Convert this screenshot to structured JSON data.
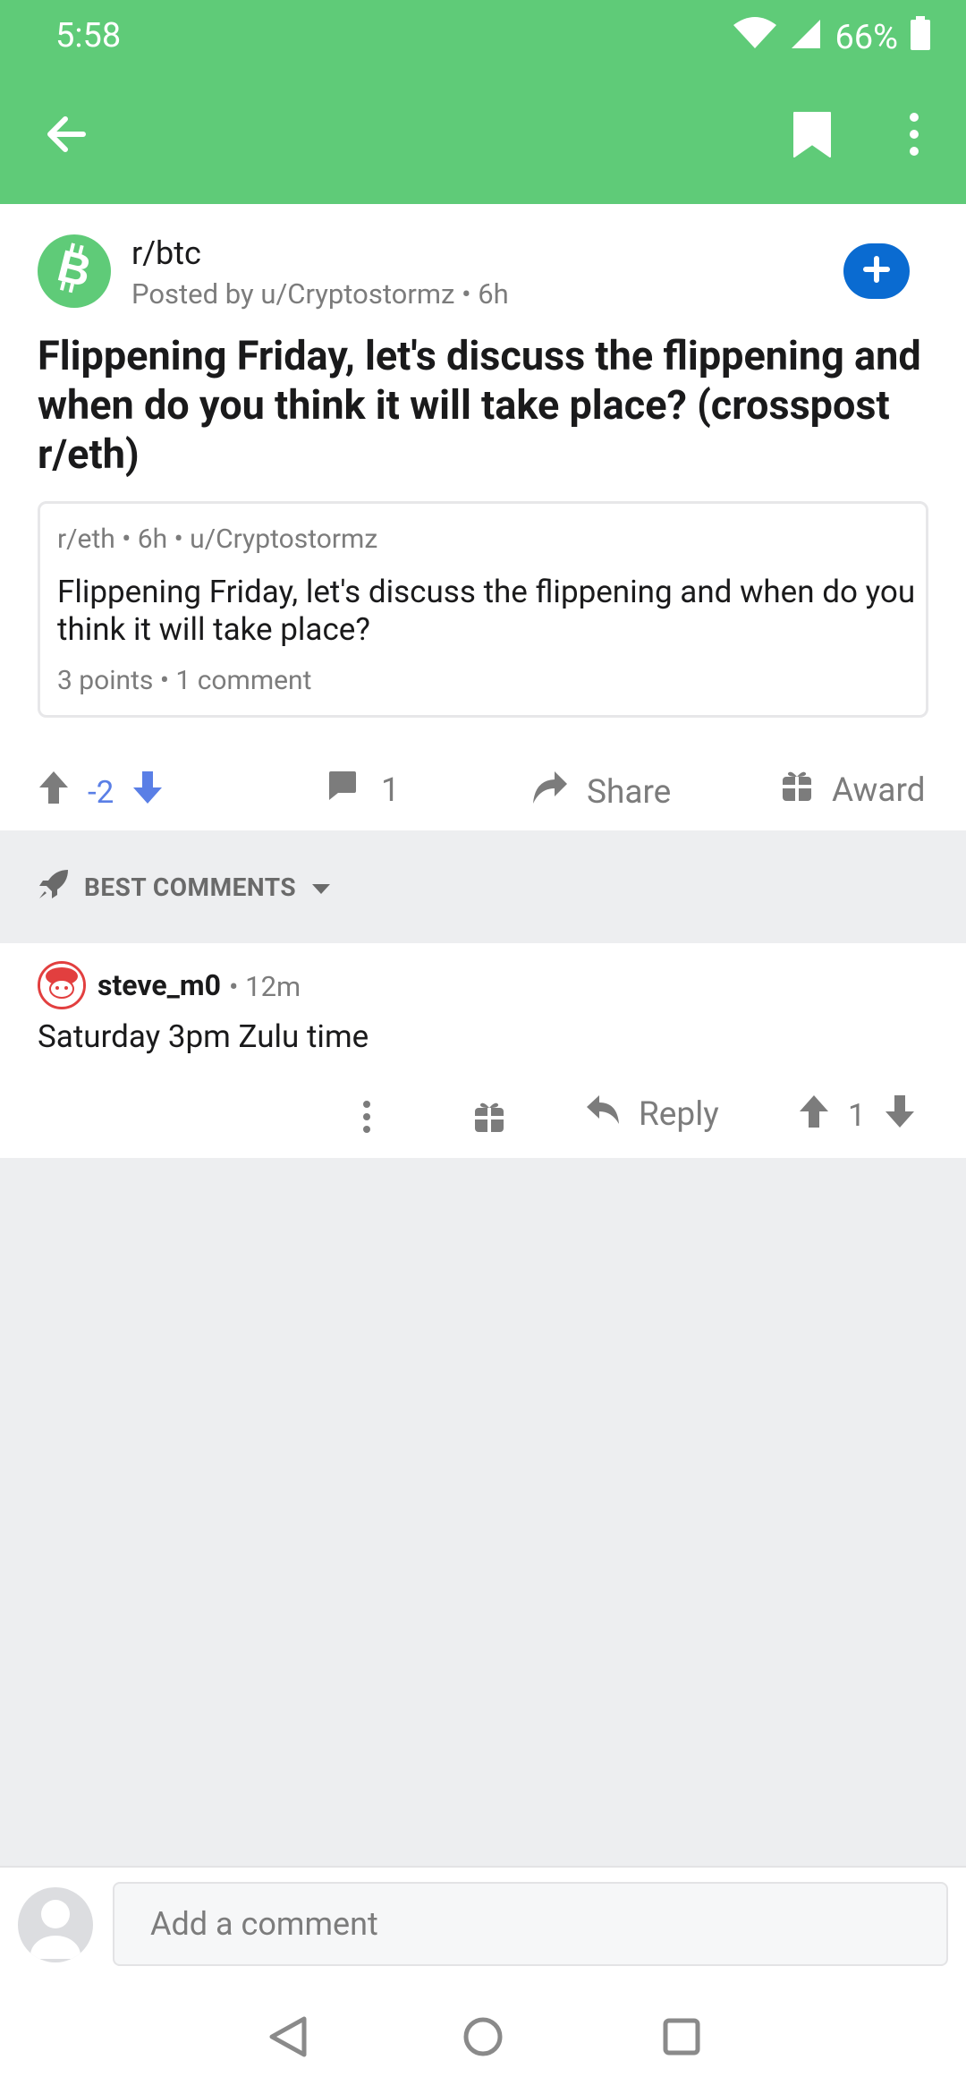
{
  "status_bar": {
    "time": "5:58",
    "battery": "66%"
  },
  "toolbar": {
    "back": "arrow-back-icon",
    "bookmark": "bookmark-icon",
    "more": "more-vertical-icon",
    "color": "#5FCB78"
  },
  "post": {
    "subreddit": "r/btc",
    "posted_by": "Posted by u/Cryptostormz • 6h",
    "title": "Flippening Friday, let's discuss the flippening and when do you think it will take place? (crosspost r/eth)",
    "crosspost": {
      "meta": "r/eth • 6h • u/Cryptostormz",
      "title": "Flippening Friday, let's discuss the flippening and when do you think it will take place?",
      "stats": "3 points • 1 comment"
    },
    "score": "-2",
    "comment_count": "1",
    "share_label": "Share",
    "award_label": "Award"
  },
  "sort": {
    "label": "BEST COMMENTS"
  },
  "comments": [
    {
      "author": "steve_m0",
      "time": "• 12m",
      "body": "Saturday 3pm Zulu time",
      "reply_label": "Reply",
      "score": "1"
    }
  ],
  "composer": {
    "placeholder": "Add a comment"
  },
  "colors": {
    "accent": "#5FCB78",
    "join": "#0A6BD1",
    "downvoted": "#5A7FE6"
  }
}
